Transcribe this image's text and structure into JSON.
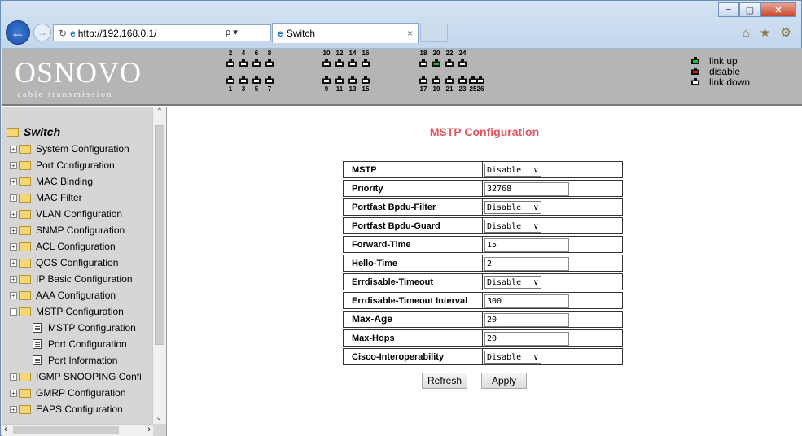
{
  "browser": {
    "url": "http://192.168.0.1/",
    "search_glyph": "ρ ▾",
    "tab_title": "Switch",
    "tab_close": "×",
    "window_buttons": [
      "−",
      "▢",
      "✕"
    ],
    "right_icons": "⌂ ★ ⚙"
  },
  "banner": {
    "logo": "OSNOVO",
    "logo_sub": "cable transmission",
    "top_port_numbers": [
      "2",
      "4",
      "6",
      "8",
      "10",
      "12",
      "14",
      "16",
      "18",
      "20",
      "22",
      "24"
    ],
    "bottom_port_numbers": [
      "1",
      "3",
      "5",
      "7",
      "9",
      "11",
      "13",
      "15",
      "17",
      "19",
      "21",
      "23",
      "25",
      "26"
    ],
    "link_up_ports": [
      "20"
    ],
    "legend": {
      "link_up": "link up",
      "disable": "disable",
      "link_down": "link down"
    },
    "colors": {
      "link_up": "#1fc22a",
      "disable": "#e01515",
      "link_down": "#ffffff"
    }
  },
  "sidebar": {
    "root": "Switch",
    "items": [
      {
        "label": "System Configuration",
        "type": "folder"
      },
      {
        "label": "Port Configuration",
        "type": "folder"
      },
      {
        "label": "MAC Binding",
        "type": "folder"
      },
      {
        "label": "MAC Filter",
        "type": "folder"
      },
      {
        "label": "VLAN Configuration",
        "type": "folder"
      },
      {
        "label": "SNMP Configuration",
        "type": "folder"
      },
      {
        "label": "ACL Configuration",
        "type": "folder"
      },
      {
        "label": "QOS Configuration",
        "type": "folder"
      },
      {
        "label": "IP Basic Configuration",
        "type": "folder"
      },
      {
        "label": "AAA Configuration",
        "type": "folder"
      },
      {
        "label": "MSTP Configuration",
        "type": "folder-open"
      },
      {
        "label": "MSTP Configuration",
        "type": "doc"
      },
      {
        "label": "Port Configuration",
        "type": "doc"
      },
      {
        "label": "Port Information",
        "type": "doc"
      },
      {
        "label": "IGMP SNOOPING Confi",
        "type": "folder"
      },
      {
        "label": "GMRP Configuration",
        "type": "folder"
      },
      {
        "label": "EAPS Configuration",
        "type": "folder"
      }
    ]
  },
  "main": {
    "title": "MSTP Configuration",
    "rows": [
      {
        "label": "MSTP",
        "kind": "select",
        "value": "Disable"
      },
      {
        "label": "Priority",
        "kind": "input",
        "value": "32768"
      },
      {
        "label": "Portfast Bpdu-Filter",
        "kind": "select",
        "value": "Disable"
      },
      {
        "label": "Portfast Bpdu-Guard",
        "kind": "select",
        "value": "Disable"
      },
      {
        "label": "Forward-Time",
        "kind": "input",
        "value": "15"
      },
      {
        "label": "Hello-Time",
        "kind": "input",
        "value": "2"
      },
      {
        "label": "Errdisable-Timeout",
        "kind": "select",
        "value": "Disable"
      },
      {
        "label": "Errdisable-Timeout Interval",
        "kind": "input",
        "value": "300"
      },
      {
        "label": "Max-Age",
        "kind": "input",
        "value": "20"
      },
      {
        "label": "Max-Hops",
        "kind": "input",
        "value": "20"
      },
      {
        "label": "Cisco-Interoperability",
        "kind": "select",
        "value": "Disable"
      }
    ],
    "refresh_label": "Refresh",
    "apply_label": "Apply"
  }
}
